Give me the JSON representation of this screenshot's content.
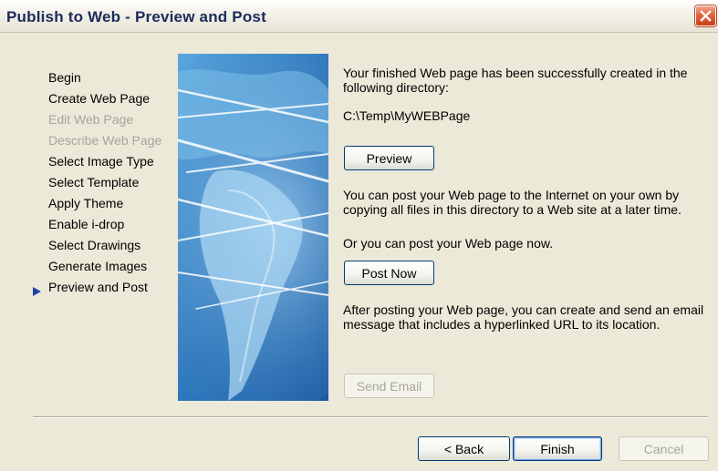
{
  "window": {
    "title": "Publish to Web - Preview and Post"
  },
  "steps": [
    {
      "label": "Begin",
      "enabled": true
    },
    {
      "label": "Create Web Page",
      "enabled": true
    },
    {
      "label": "Edit Web Page",
      "enabled": false
    },
    {
      "label": "Describe Web Page",
      "enabled": false
    },
    {
      "label": "Select Image Type",
      "enabled": true
    },
    {
      "label": "Select Template",
      "enabled": true
    },
    {
      "label": "Apply Theme",
      "enabled": true
    },
    {
      "label": "Enable i-drop",
      "enabled": true
    },
    {
      "label": "Select Drawings",
      "enabled": true
    },
    {
      "label": "Generate Images",
      "enabled": true
    },
    {
      "label": "Preview and Post",
      "enabled": true,
      "current": true
    }
  ],
  "content": {
    "success_text": "Your finished Web page has been successfully created in the following directory:",
    "directory": "C:\\Temp\\MyWEBPage",
    "preview_label": "Preview",
    "post_later_text": "You can post your Web page to the Internet on your own by copying all files in this directory to a Web site at a later time.",
    "post_now_text": "Or you can post your Web page now.",
    "post_now_label": "Post Now",
    "email_text": "After posting your Web page, you can create and send an email message that includes a hyperlinked URL to its location.",
    "send_email_label": "Send Email"
  },
  "footer": {
    "back_label": "< Back",
    "finish_label": "Finish",
    "cancel_label": "Cancel"
  },
  "colors": {
    "dialog_bg": "#ece9d8",
    "title_text": "#1c2b5a",
    "disabled_text": "#a7a59d",
    "close_button": "#e0643d",
    "arrow": "#1f3fa8"
  }
}
